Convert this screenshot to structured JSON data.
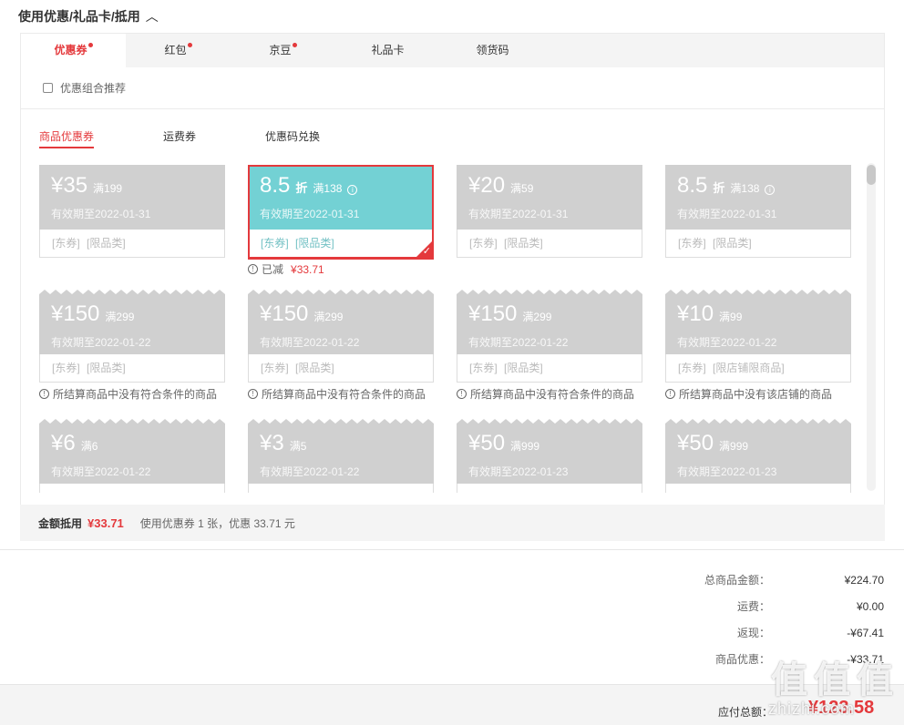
{
  "header": {
    "title": "使用优惠/礼品卡/抵用",
    "chevron": "^"
  },
  "tabs": [
    {
      "label": "优惠券",
      "dot": true,
      "active": true
    },
    {
      "label": "红包",
      "dot": true,
      "active": false
    },
    {
      "label": "京豆",
      "dot": true,
      "active": false
    },
    {
      "label": "礼品卡",
      "dot": false,
      "active": false
    },
    {
      "label": "领货码",
      "dot": false,
      "active": false
    }
  ],
  "combo": {
    "label": "优惠组合推荐"
  },
  "subtabs": [
    "商品优惠券",
    "运费券",
    "优惠码兑换"
  ],
  "coupons": [
    {
      "amount": "¥35",
      "unit": "",
      "cond": "满199",
      "info": false,
      "valid": "有效期至2022-01-31",
      "tags": "[东券] [限品类]",
      "note": "",
      "note_amt": "",
      "selected": false,
      "wavy": false
    },
    {
      "amount": "8.5",
      "unit": "折",
      "cond": "满138",
      "info": true,
      "valid": "有效期至2022-01-31",
      "tags": "[东券] [限品类]",
      "note": "已减",
      "note_amt": "¥33.71",
      "selected": true,
      "wavy": false
    },
    {
      "amount": "¥20",
      "unit": "",
      "cond": "满59",
      "info": false,
      "valid": "有效期至2022-01-31",
      "tags": "[东券] [限品类]",
      "note": "",
      "note_amt": "",
      "selected": false,
      "wavy": false
    },
    {
      "amount": "8.5",
      "unit": "折",
      "cond": "满138",
      "info": true,
      "valid": "有效期至2022-01-31",
      "tags": "[东券] [限品类]",
      "note": "",
      "note_amt": "",
      "selected": false,
      "wavy": false
    },
    {
      "amount": "¥150",
      "unit": "",
      "cond": "满299",
      "info": false,
      "valid": "有效期至2022-01-22",
      "tags": "[东券] [限品类]",
      "note": "所结算商品中没有符合条件的商品",
      "note_amt": "",
      "selected": false,
      "wavy": true
    },
    {
      "amount": "¥150",
      "unit": "",
      "cond": "满299",
      "info": false,
      "valid": "有效期至2022-01-22",
      "tags": "[东券] [限品类]",
      "note": "所结算商品中没有符合条件的商品",
      "note_amt": "",
      "selected": false,
      "wavy": true
    },
    {
      "amount": "¥150",
      "unit": "",
      "cond": "满299",
      "info": false,
      "valid": "有效期至2022-01-22",
      "tags": "[东券] [限品类]",
      "note": "所结算商品中没有符合条件的商品",
      "note_amt": "",
      "selected": false,
      "wavy": true
    },
    {
      "amount": "¥10",
      "unit": "",
      "cond": "满99",
      "info": false,
      "valid": "有效期至2022-01-22",
      "tags": "[东券] [限店铺限商品]",
      "note": "所结算商品中没有该店铺的商品",
      "note_amt": "",
      "selected": false,
      "wavy": true
    },
    {
      "amount": "¥6",
      "unit": "",
      "cond": "满6",
      "info": false,
      "valid": "有效期至2022-01-22",
      "tags": "",
      "note": "",
      "note_amt": "",
      "selected": false,
      "wavy": true
    },
    {
      "amount": "¥3",
      "unit": "",
      "cond": "满5",
      "info": false,
      "valid": "有效期至2022-01-22",
      "tags": "",
      "note": "",
      "note_amt": "",
      "selected": false,
      "wavy": true
    },
    {
      "amount": "¥50",
      "unit": "",
      "cond": "满999",
      "info": false,
      "valid": "有效期至2022-01-23",
      "tags": "",
      "note": "",
      "note_amt": "",
      "selected": false,
      "wavy": true
    },
    {
      "amount": "¥50",
      "unit": "",
      "cond": "满999",
      "info": false,
      "valid": "有效期至2022-01-23",
      "tags": "",
      "note": "",
      "note_amt": "",
      "selected": false,
      "wavy": true
    }
  ],
  "summary": {
    "label": "金额抵用",
    "amount": "¥33.71",
    "text": "使用优惠券 1 张，优惠 33.71 元"
  },
  "totals": [
    {
      "label": "总商品金额：",
      "value": "¥224.70"
    },
    {
      "label": "运费：",
      "value": "¥0.00"
    },
    {
      "label": "返现：",
      "value": "-¥67.41"
    },
    {
      "label": "商品优惠：",
      "value": "-¥33.71"
    }
  ],
  "pay": {
    "label": "应付总额：",
    "value": "¥123.58"
  },
  "watermark": {
    "glyphs": [
      "值",
      "值",
      "值"
    ],
    "text": "zhizhi.com"
  },
  "colors": {
    "accent": "#e4393c",
    "selected": "#73d1d4",
    "disabled": "#d0d0d0"
  }
}
